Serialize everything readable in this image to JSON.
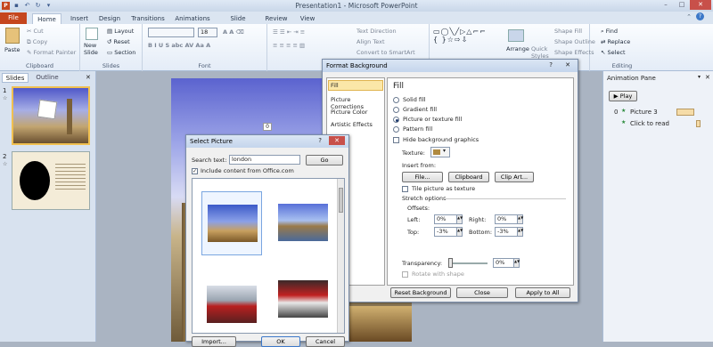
{
  "app": {
    "title": "Presentation1 - Microsoft PowerPoint",
    "file_tab": "File",
    "tabs": [
      "Home",
      "Insert",
      "Design",
      "Transitions",
      "Animations",
      "Slide Show",
      "Review",
      "View"
    ]
  },
  "ribbon": {
    "clipboard": {
      "paste": "Paste",
      "cut": "Cut",
      "copy": "Copy",
      "format_painter": "Format Painter",
      "label": "Clipboard"
    },
    "slides": {
      "new_slide": "New Slide",
      "layout": "Layout",
      "reset": "Reset",
      "section": "Section",
      "label": "Slides"
    },
    "font": {
      "size": "18",
      "label": "Font"
    },
    "paragraph": {
      "text_direction": "Text Direction",
      "align_text": "Align Text",
      "convert": "Convert to SmartArt"
    },
    "drawing": {
      "arrange": "Arrange",
      "quick_styles": "Quick Styles",
      "shape_fill": "Shape Fill",
      "shape_outline": "Shape Outline",
      "shape_effects": "Shape Effects"
    },
    "editing": {
      "find": "Find",
      "replace": "Replace",
      "select": "Select",
      "label": "Editing"
    }
  },
  "slides_pane": {
    "tabs": [
      "Slides",
      "Outline"
    ],
    "numbers": [
      "1",
      "2"
    ]
  },
  "slide": {
    "badge": "0"
  },
  "animation_pane": {
    "title": "Animation Pane",
    "play": "Play",
    "items": [
      {
        "num": "0",
        "name": "Picture 3"
      },
      {
        "num": "",
        "name": "Click to read"
      }
    ]
  },
  "format_background": {
    "title": "Format Background",
    "nav": [
      "Fill",
      "Picture Corrections",
      "Picture Color",
      "Artistic Effects"
    ],
    "heading": "Fill",
    "options": [
      "Solid fill",
      "Gradient fill",
      "Picture or texture fill",
      "Pattern fill"
    ],
    "hide_graphics": "Hide background graphics",
    "texture_label": "Texture:",
    "insert_from": "Insert from:",
    "file_btn": "File...",
    "clipboard_btn": "Clipboard",
    "clipart_btn": "Clip Art...",
    "tile": "Tile picture as texture",
    "stretch": "Stretch options",
    "offsets": "Offsets:",
    "left_lbl": "Left:",
    "left_val": "0%",
    "right_lbl": "Right:",
    "right_val": "0%",
    "top_lbl": "Top:",
    "top_val": "-3%",
    "bottom_lbl": "Bottom:",
    "bottom_val": "-3%",
    "transparency_lbl": "Transparency:",
    "transparency_val": "0%",
    "transparency_level": 0,
    "rotate": "Rotate with shape",
    "reset_btn": "Reset Background",
    "close_btn": "Close",
    "apply_btn": "Apply to All"
  },
  "select_picture": {
    "title": "Select Picture",
    "search_label": "Search text:",
    "search_value": "london",
    "go": "Go",
    "include": "Include content from Office.com",
    "import_btn": "Import...",
    "ok_btn": "OK",
    "cancel_btn": "Cancel"
  }
}
